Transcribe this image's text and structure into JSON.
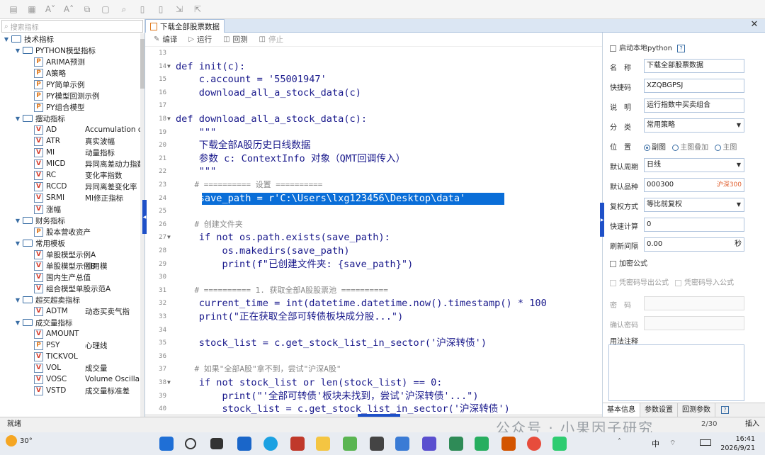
{
  "toolbar": {
    "icons": [
      "new-file-icon",
      "save-icon",
      "font-decrease-icon",
      "font-increase-icon",
      "copy-icon",
      "paste-icon",
      "find-icon",
      "doc-icon",
      "doc2-icon",
      "import-icon",
      "export-icon"
    ]
  },
  "left": {
    "search_placeholder": "搜索指标",
    "tree": [
      {
        "level": 0,
        "type": "folder",
        "label": "技术指标"
      },
      {
        "level": 1,
        "type": "folder",
        "label": "PYTHON模型指标"
      },
      {
        "level": 2,
        "type": "py",
        "label": "ARIMA预测"
      },
      {
        "level": 2,
        "type": "py",
        "label": "A策略"
      },
      {
        "level": 2,
        "type": "py",
        "label": "PY简单示例"
      },
      {
        "level": 2,
        "type": "py",
        "label": "PY模型回测示例"
      },
      {
        "level": 2,
        "type": "py",
        "label": "PY组合模型"
      },
      {
        "level": 1,
        "type": "folder",
        "label": "摆动指标"
      },
      {
        "level": 2,
        "type": "v",
        "label": "AD",
        "desc": "Accumulation or"
      },
      {
        "level": 2,
        "type": "v",
        "label": "ATR",
        "desc": "真实波幅"
      },
      {
        "level": 2,
        "type": "v",
        "label": "MI",
        "desc": "动量指标"
      },
      {
        "level": 2,
        "type": "v",
        "label": "MICD",
        "desc": "异同离差动力指数"
      },
      {
        "level": 2,
        "type": "v",
        "label": "RC",
        "desc": "变化率指数"
      },
      {
        "level": 2,
        "type": "v",
        "label": "RCCD",
        "desc": "异同离差变化率"
      },
      {
        "level": 2,
        "type": "v",
        "label": "SRMI",
        "desc": "MI修正指标"
      },
      {
        "level": 2,
        "type": "v",
        "label": "涨幅"
      },
      {
        "level": 1,
        "type": "folder",
        "label": "财务指标"
      },
      {
        "level": 2,
        "type": "py",
        "label": "股本营收资产"
      },
      {
        "level": 1,
        "type": "folder",
        "label": "常用模板"
      },
      {
        "level": 2,
        "type": "v",
        "label": "单股模型示例A"
      },
      {
        "level": 2,
        "type": "v",
        "label": "单股模型示例B",
        "desc": "引用模"
      },
      {
        "level": 2,
        "type": "v",
        "label": "国内生产总值"
      },
      {
        "level": 2,
        "type": "v",
        "label": "组合模型单股示范A"
      },
      {
        "level": 1,
        "type": "folder",
        "label": "超买超卖指标"
      },
      {
        "level": 2,
        "type": "v",
        "label": "ADTM",
        "desc": "动态买卖气指"
      },
      {
        "level": 1,
        "type": "folder",
        "label": "成交量指标"
      },
      {
        "level": 2,
        "type": "v",
        "label": "AMOUNT"
      },
      {
        "level": 2,
        "type": "py",
        "label": "PSY",
        "desc": "心理线"
      },
      {
        "level": 2,
        "type": "v",
        "label": "TICKVOL"
      },
      {
        "level": 2,
        "type": "v",
        "label": "VOL",
        "desc": "成交量"
      },
      {
        "level": 2,
        "type": "v",
        "label": "VOSC",
        "desc": "Volume Oscilla"
      },
      {
        "level": 2,
        "type": "v",
        "label": "VSTD",
        "desc": "成交量标准差"
      }
    ],
    "tabs": [
      "模型",
      "函数"
    ]
  },
  "editor": {
    "tab_title": "下载全部股票数据",
    "buttons": [
      {
        "label": "编译",
        "enabled": true
      },
      {
        "label": "运行",
        "enabled": true
      },
      {
        "label": "回测",
        "enabled": true
      },
      {
        "label": "停止",
        "enabled": false
      }
    ],
    "lines": [
      {
        "n": "13",
        "t": ""
      },
      {
        "n": "14",
        "t": "def init(c):",
        "fold": true
      },
      {
        "n": "15",
        "t": "    c.account = '55001947'"
      },
      {
        "n": "16",
        "t": "    download_all_a_stock_data(c)"
      },
      {
        "n": "17",
        "t": ""
      },
      {
        "n": "18",
        "t": "def download_all_a_stock_data(c):",
        "fold": true
      },
      {
        "n": "19",
        "t": "    \"\"\""
      },
      {
        "n": "20",
        "t": "    下载全部A股历史日线数据"
      },
      {
        "n": "21",
        "t": "    参数 c: ContextInfo 对象（QMT回调传入）"
      },
      {
        "n": "22",
        "t": "    \"\"\""
      },
      {
        "n": "23",
        "t": "    # ========== 设置 ==========",
        "cm": true
      },
      {
        "n": "24",
        "t": "    save_path = r'C:\\Users\\lxg123456\\Desktop\\data'",
        "sel": true
      },
      {
        "n": "25",
        "t": ""
      },
      {
        "n": "26",
        "t": "    # 创建文件夹",
        "cm": true
      },
      {
        "n": "27",
        "t": "    if not os.path.exists(save_path):",
        "fold": true
      },
      {
        "n": "28",
        "t": "        os.makedirs(save_path)"
      },
      {
        "n": "29",
        "t": "        print(f\"已创建文件夹: {save_path}\")"
      },
      {
        "n": "30",
        "t": ""
      },
      {
        "n": "31",
        "t": "    # ========== 1. 获取全部A股股票池 ==========",
        "cm": true
      },
      {
        "n": "32",
        "t": "    current_time = int(datetime.datetime.now().timestamp() * 100"
      },
      {
        "n": "33",
        "t": "    print(\"正在获取全部可转债板块成分股...\")"
      },
      {
        "n": "34",
        "t": ""
      },
      {
        "n": "35",
        "t": "    stock_list = c.get_stock_list_in_sector('沪深转债')"
      },
      {
        "n": "36",
        "t": ""
      },
      {
        "n": "37",
        "t": "    # 如果\"全部A股\"拿不到，尝试\"沪深A股\"",
        "cm": true
      },
      {
        "n": "38",
        "t": "    if not stock_list or len(stock_list) == 0:",
        "fold": true
      },
      {
        "n": "39",
        "t": "        print(\"'全部可转债'板块未找到，尝试'沪深转债'...\")"
      },
      {
        "n": "40",
        "t": "        stock_list = c.get_stock_list_in_sector('沪深转债')"
      }
    ]
  },
  "props": {
    "local_python": "启动本地python",
    "help": "?",
    "name_label": "名　称",
    "name_value": "下载全部股票数据",
    "code_label": "快捷码",
    "code_value": "XZQBGPSJ",
    "desc_label": "说　明",
    "desc_value": "运行指数中买卖组合",
    "cat_label": "分　类",
    "cat_value": "常用策略",
    "pos_label": "位　置",
    "pos_options": [
      "副图",
      "主图叠加",
      "主图"
    ],
    "period_label": "默认周期",
    "period_value": "日线",
    "variety_label": "默认品种",
    "variety_value": "000300",
    "variety_tag": "沪深300",
    "adjust_label": "复权方式",
    "adjust_value": "等比前复权",
    "quick_label": "快速计算",
    "quick_value": "0",
    "refresh_label": "刷新间隔",
    "refresh_value": "0.00",
    "refresh_unit": "秒",
    "encrypt": "加密公式",
    "export_pw": "凭密码导出公式",
    "import_pw": "凭密码导入公式",
    "pw_label": "密　码",
    "pw2_label": "确认密码",
    "usage_label": "用法注释",
    "tabs": [
      "基本信息",
      "参数设置",
      "回测参数"
    ]
  },
  "status": {
    "text": "就绪",
    "insert": "插入",
    "cursor": "2/30"
  },
  "taskbar": {
    "weather": "30°",
    "time": "16:41",
    "date": "2026/9/21",
    "ime": "中"
  },
  "watermark": "公众号 · 小果因子研究",
  "colors": {
    "accent": "#1e50c8",
    "selection": "#0a6ed8"
  }
}
